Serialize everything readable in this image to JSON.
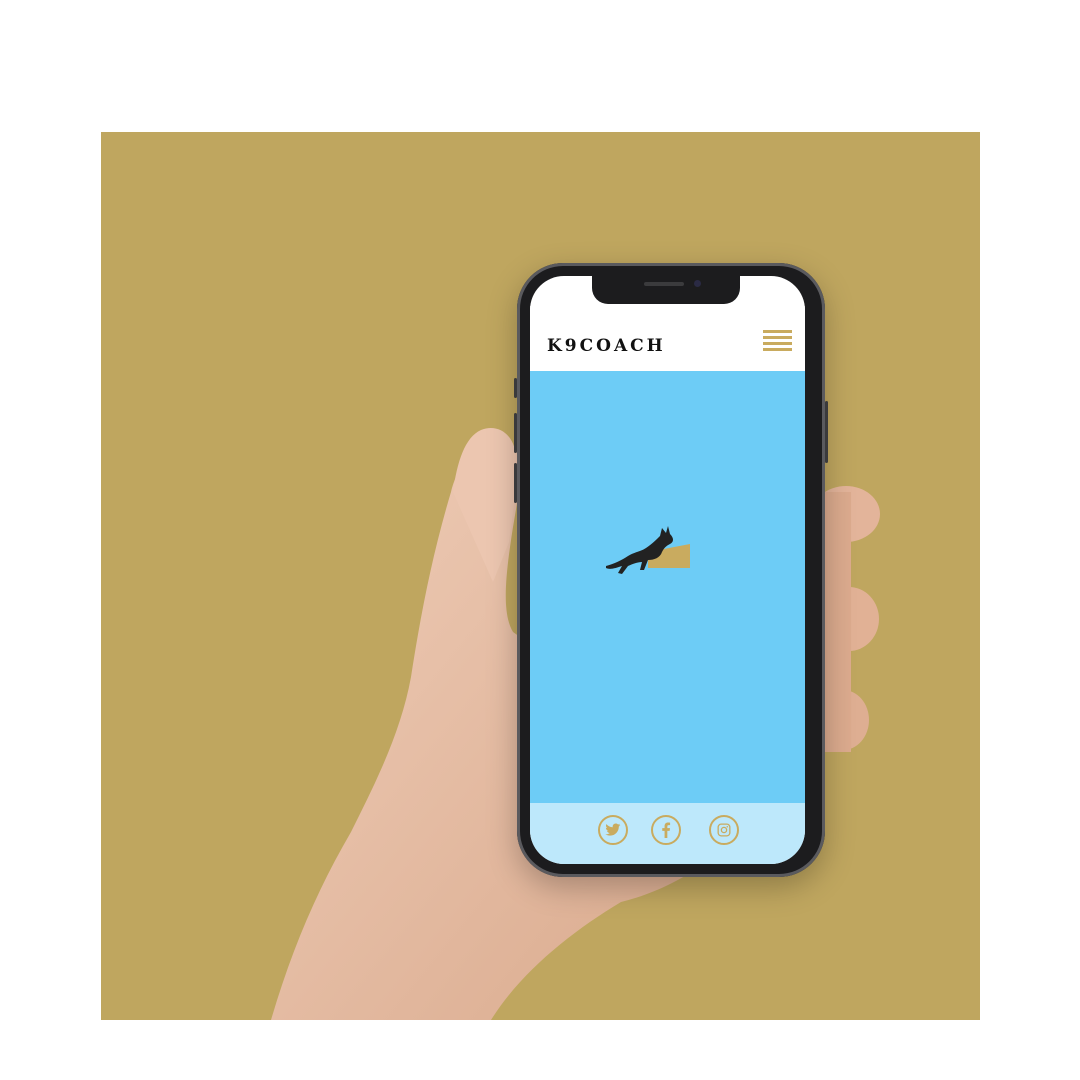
{
  "brand": {
    "name": "K9COACH"
  },
  "colors": {
    "backdrop": "#bfa65f",
    "accent_gold": "#c9ab5f",
    "hero_blue": "#6dccf6",
    "footer_blue": "#bde8fb",
    "phone_body": "#1c1c1e"
  },
  "header": {
    "menu_icon": "hamburger-menu-icon"
  },
  "hero": {
    "illustration": "jumping-dog-icon"
  },
  "footer": {
    "social": [
      {
        "icon": "twitter-icon"
      },
      {
        "icon": "facebook-icon"
      },
      {
        "icon": "instagram-icon"
      }
    ]
  }
}
